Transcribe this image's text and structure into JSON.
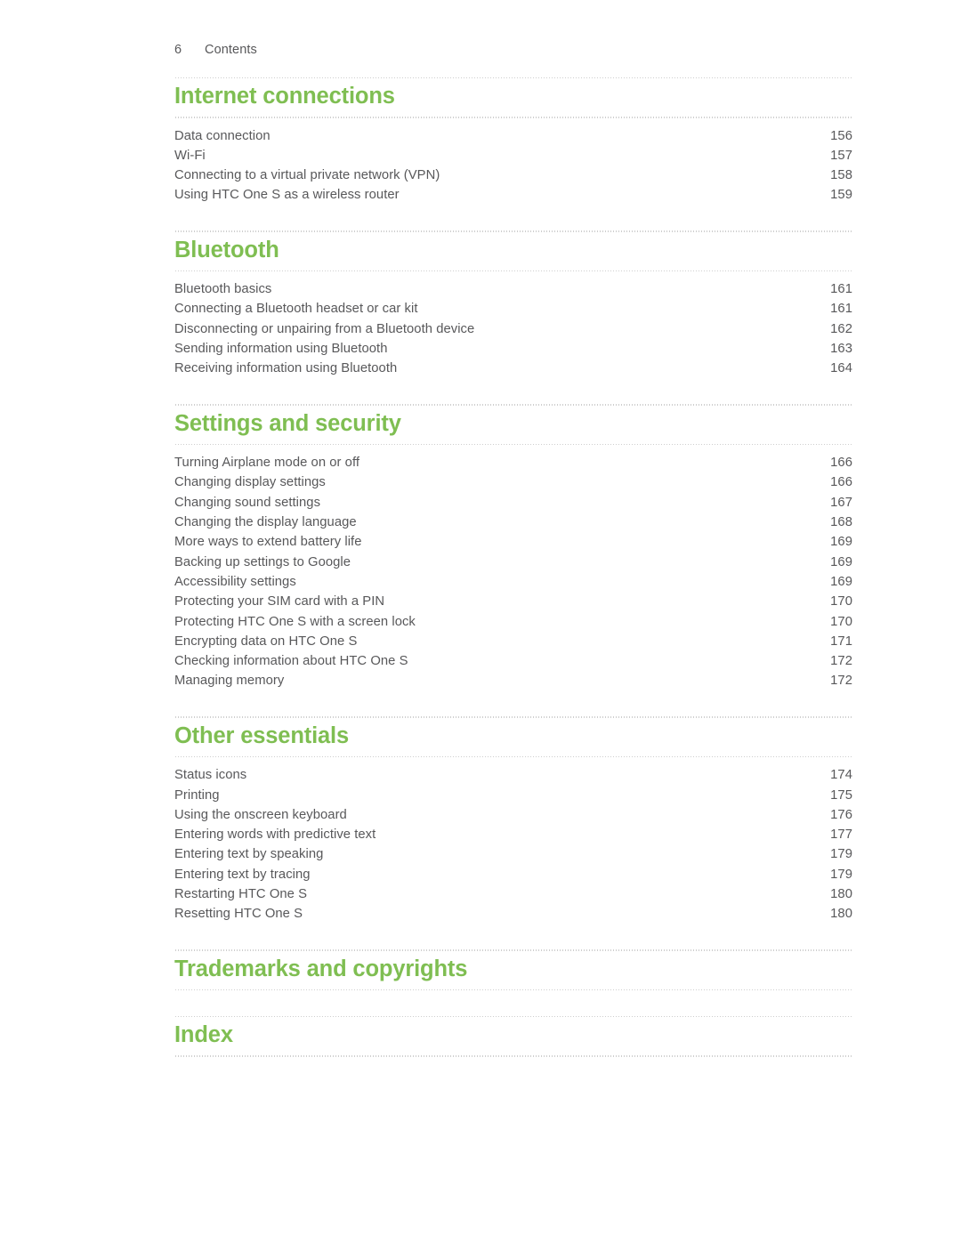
{
  "header": {
    "folio": "6",
    "label": "Contents"
  },
  "colors": {
    "heading_green": "#7fbe52",
    "body_gray": "#58585a",
    "rule_gray": "#8c8c8c"
  },
  "sections": [
    {
      "heading": "Internet connections",
      "entries": [
        {
          "title": "Data connection",
          "page": "156"
        },
        {
          "title": "Wi-Fi",
          "page": "157"
        },
        {
          "title": "Connecting to a virtual private network (VPN)",
          "page": "158"
        },
        {
          "title": "Using HTC One S as a wireless router",
          "page": "159"
        }
      ]
    },
    {
      "heading": "Bluetooth",
      "entries": [
        {
          "title": "Bluetooth basics",
          "page": "161"
        },
        {
          "title": "Connecting a Bluetooth headset or car kit",
          "page": "161"
        },
        {
          "title": "Disconnecting or unpairing from a Bluetooth device",
          "page": "162"
        },
        {
          "title": "Sending information using Bluetooth",
          "page": "163"
        },
        {
          "title": "Receiving information using Bluetooth",
          "page": "164"
        }
      ]
    },
    {
      "heading": "Settings and security",
      "entries": [
        {
          "title": "Turning Airplane mode on or off",
          "page": "166"
        },
        {
          "title": "Changing display settings",
          "page": "166"
        },
        {
          "title": "Changing sound settings",
          "page": "167"
        },
        {
          "title": "Changing the display language",
          "page": "168"
        },
        {
          "title": "More ways to extend battery life",
          "page": "169"
        },
        {
          "title": "Backing up settings to Google",
          "page": "169"
        },
        {
          "title": "Accessibility settings",
          "page": "169"
        },
        {
          "title": "Protecting your SIM card with a PIN",
          "page": "170"
        },
        {
          "title": "Protecting HTC One S with a screen lock",
          "page": "170"
        },
        {
          "title": "Encrypting data on HTC One S",
          "page": "171"
        },
        {
          "title": "Checking information about HTC One S",
          "page": "172"
        },
        {
          "title": "Managing memory",
          "page": "172"
        }
      ]
    },
    {
      "heading": "Other essentials",
      "entries": [
        {
          "title": "Status icons",
          "page": "174"
        },
        {
          "title": "Printing",
          "page": "175"
        },
        {
          "title": "Using the onscreen keyboard",
          "page": "176"
        },
        {
          "title": "Entering words with predictive text",
          "page": "177"
        },
        {
          "title": "Entering text by speaking",
          "page": "179"
        },
        {
          "title": "Entering text by tracing",
          "page": "179"
        },
        {
          "title": "Restarting HTC One S",
          "page": "180"
        },
        {
          "title": "Resetting HTC One S",
          "page": "180"
        }
      ]
    },
    {
      "heading": "Trademarks and copyrights",
      "entries": []
    },
    {
      "heading": "Index",
      "entries": []
    }
  ]
}
